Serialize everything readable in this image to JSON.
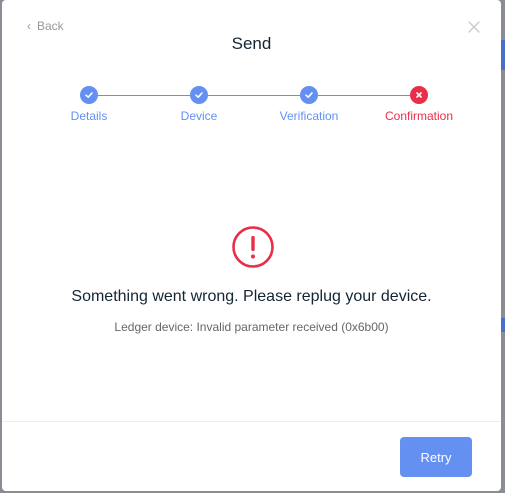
{
  "header": {
    "back_label": "Back",
    "title": "Send"
  },
  "stepper": {
    "steps": [
      {
        "label": "Details",
        "status": "complete"
      },
      {
        "label": "Device",
        "status": "complete"
      },
      {
        "label": "Verification",
        "status": "complete"
      },
      {
        "label": "Confirmation",
        "status": "error"
      }
    ]
  },
  "error": {
    "icon": "alert-circle-icon",
    "title": "Something went wrong. Please replug your device.",
    "description": "Ledger device: Invalid parameter received (0x6b00)"
  },
  "footer": {
    "retry_label": "Retry"
  },
  "colors": {
    "accent": "#6490f1",
    "error": "#ea2e49",
    "text": "#142533",
    "muted": "#999999"
  }
}
